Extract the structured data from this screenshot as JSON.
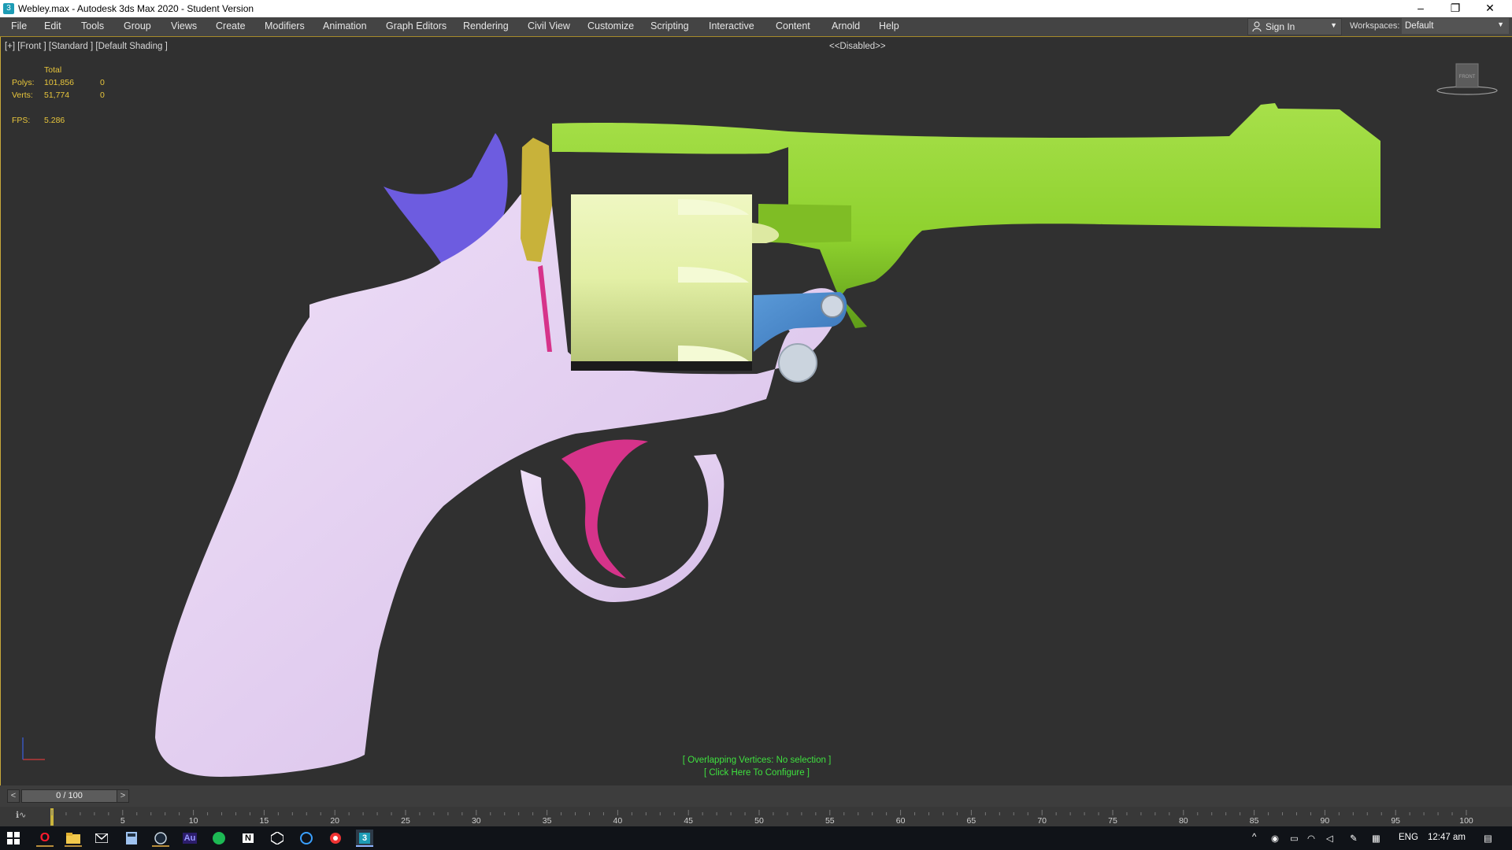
{
  "window": {
    "title": "Webley.max - Autodesk 3ds Max 2020 - Student Version",
    "minimize": "–",
    "restore": "❐",
    "close": "✕"
  },
  "menu": {
    "items": [
      "File",
      "Edit",
      "Tools",
      "Group",
      "Views",
      "Create",
      "Modifiers",
      "Animation",
      "Graph Editors",
      "Rendering",
      "Civil View",
      "Customize",
      "Scripting",
      "Interactive",
      "Content",
      "Arnold",
      "Help"
    ]
  },
  "signin": {
    "label": "Sign In"
  },
  "workspaces": {
    "label": "Workspaces:",
    "value": "Default"
  },
  "viewport": {
    "label": "[+] [Front ] [Standard ] [Default Shading ]",
    "disabled_text": "<<Disabled>>",
    "navcube_label": "FRONT",
    "stats": {
      "total_label": "Total",
      "polys_label": "Polys:",
      "polys_total": "101,856",
      "polys_sel": "0",
      "verts_label": "Verts:",
      "verts_total": "51,774",
      "verts_sel": "0",
      "fps_label": "FPS:",
      "fps_value": "5.286"
    },
    "overlap_line1": "[ Overlapping Vertices: No selection ]",
    "overlap_line2": "[ Click Here To Configure ]",
    "model_colors": {
      "grip_frame": "#e3cdf0",
      "barrel": "#8ed12e",
      "cylinder": "#e3f0a6",
      "hammer": "#6d5ce0",
      "latch": "#c8b23a",
      "trigger": "#d6338a",
      "lock_plate": "#4b8ccd"
    }
  },
  "timeslider": {
    "prev": "<",
    "next": ">",
    "frame": "0 / 100"
  },
  "trackbar": {
    "icon": "ℹ∿",
    "ticks": [
      "5",
      "10",
      "15",
      "20",
      "25",
      "30",
      "35",
      "40",
      "45",
      "50",
      "55",
      "60",
      "65",
      "70",
      "75",
      "80",
      "85",
      "90",
      "95",
      "100"
    ]
  },
  "taskbar": {
    "lang": "ENG",
    "time": "12:47 am",
    "apps": [
      "start",
      "opera",
      "file-explorer",
      "mail",
      "calculator",
      "steam",
      "audition",
      "spotify",
      "notion",
      "unity",
      "copilot",
      "recorder",
      "3dsmax"
    ]
  }
}
